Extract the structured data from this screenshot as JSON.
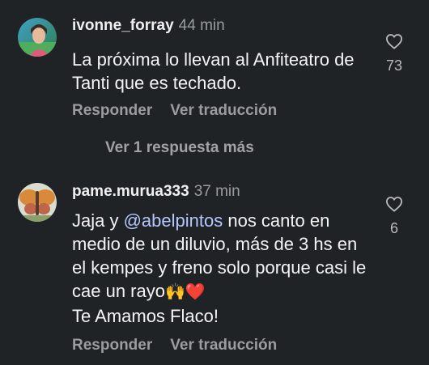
{
  "comments": [
    {
      "username": "ivonne_forray",
      "time": "44 min",
      "text": "La próxima lo llevan al Anfiteatro de Tanti que es techado.",
      "reply_label": "Responder",
      "translate_label": "Ver traducción",
      "like_count": "73",
      "avatar_icon": "user-photo"
    },
    {
      "username": "pame.murua333",
      "time": "37 min",
      "text_before": "Jaja y ",
      "mention": "@abelpintos",
      "text_after": " nos canto en medio de un diluvio,  más de 3 hs en el kempes y freno solo porque casi le cae un rayo",
      "emojis": "🙌❤️",
      "text_end": "Te Amamos Flaco!",
      "reply_label": "Responder",
      "translate_label": "Ver traducción",
      "like_count": "6",
      "avatar_icon": "butterfly-photo"
    }
  ],
  "view_replies": "Ver 1 respuesta más",
  "colors": {
    "background": "#202326",
    "secondary_text": "#9a9ca0",
    "mention": "#b8c6ff"
  }
}
